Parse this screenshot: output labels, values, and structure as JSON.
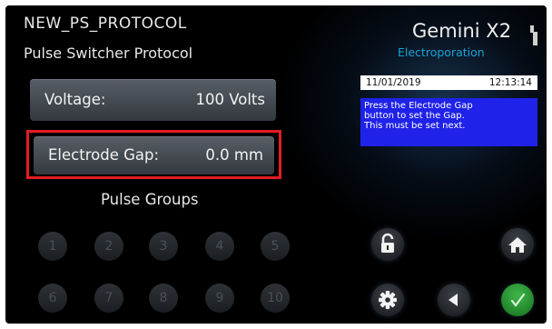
{
  "header": {
    "protocol_name": "NEW_PS_PROTOCOL",
    "protocol_description": "Pulse Switcher Protocol",
    "brand": "Gemini X2",
    "brand_subtitle": "Electroporation"
  },
  "fields": {
    "voltage": {
      "label": "Voltage:",
      "value": "100 Volts"
    },
    "electrode_gap": {
      "label": "Electrode Gap:",
      "value": "0.0 mm"
    }
  },
  "pulse_groups": {
    "title": "Pulse Groups",
    "buttons": [
      "1",
      "2",
      "3",
      "4",
      "5",
      "6",
      "7",
      "8",
      "9",
      "10"
    ]
  },
  "status": {
    "date": "11/01/2019",
    "time": "12:13:14",
    "message_lines": [
      "Press the Electrode Gap",
      "button to set the Gap.",
      "This must be set next."
    ]
  },
  "icons": {
    "unlock": "unlock-icon",
    "home": "home-icon",
    "settings": "gear-icon",
    "back": "back-arrow-icon",
    "confirm": "checkmark-icon",
    "usb": "usb-icon"
  },
  "colors": {
    "highlight_box": "#e31b23",
    "message_background": "#1f22e8",
    "brand_subtitle": "#1aa3d8",
    "confirm_button": "#2fa33a"
  }
}
